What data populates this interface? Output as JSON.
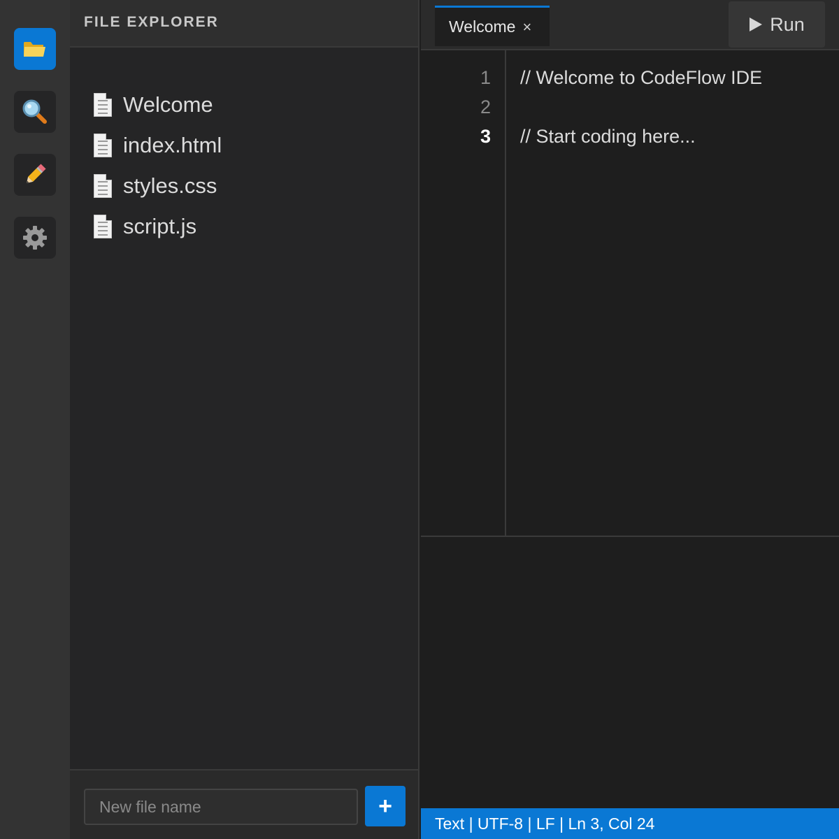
{
  "activity_bar": {
    "items": [
      {
        "name": "explorer",
        "icon": "folder-icon",
        "active": true
      },
      {
        "name": "search",
        "icon": "search-icon",
        "active": false
      },
      {
        "name": "edit",
        "icon": "pencil-icon",
        "active": false
      },
      {
        "name": "settings",
        "icon": "gear-icon",
        "active": false
      }
    ]
  },
  "explorer": {
    "title": "FILE EXPLORER",
    "files": [
      {
        "label": "Welcome",
        "icon": "file-icon"
      },
      {
        "label": "index.html",
        "icon": "file-icon"
      },
      {
        "label": "styles.css",
        "icon": "file-icon"
      },
      {
        "label": "script.js",
        "icon": "file-icon"
      }
    ],
    "new_file": {
      "placeholder": "New file name",
      "value": "",
      "add_label": "+"
    }
  },
  "editor": {
    "tabs": [
      {
        "label": "Welcome",
        "close": "×",
        "active": true
      }
    ],
    "run_label": "Run",
    "lines": [
      {
        "number": "1",
        "text": "// Welcome to CodeFlow IDE",
        "current": false
      },
      {
        "number": "2",
        "text": "",
        "current": false
      },
      {
        "number": "3",
        "text": "// Start coding here...",
        "current": true
      }
    ]
  },
  "status_bar": {
    "text": "Text | UTF-8 | LF | Ln 3, Col 24"
  },
  "colors": {
    "accent": "#0a78d4",
    "background": "#1e1e1e",
    "sidebar": "#252526",
    "activity_bar": "#333333"
  }
}
